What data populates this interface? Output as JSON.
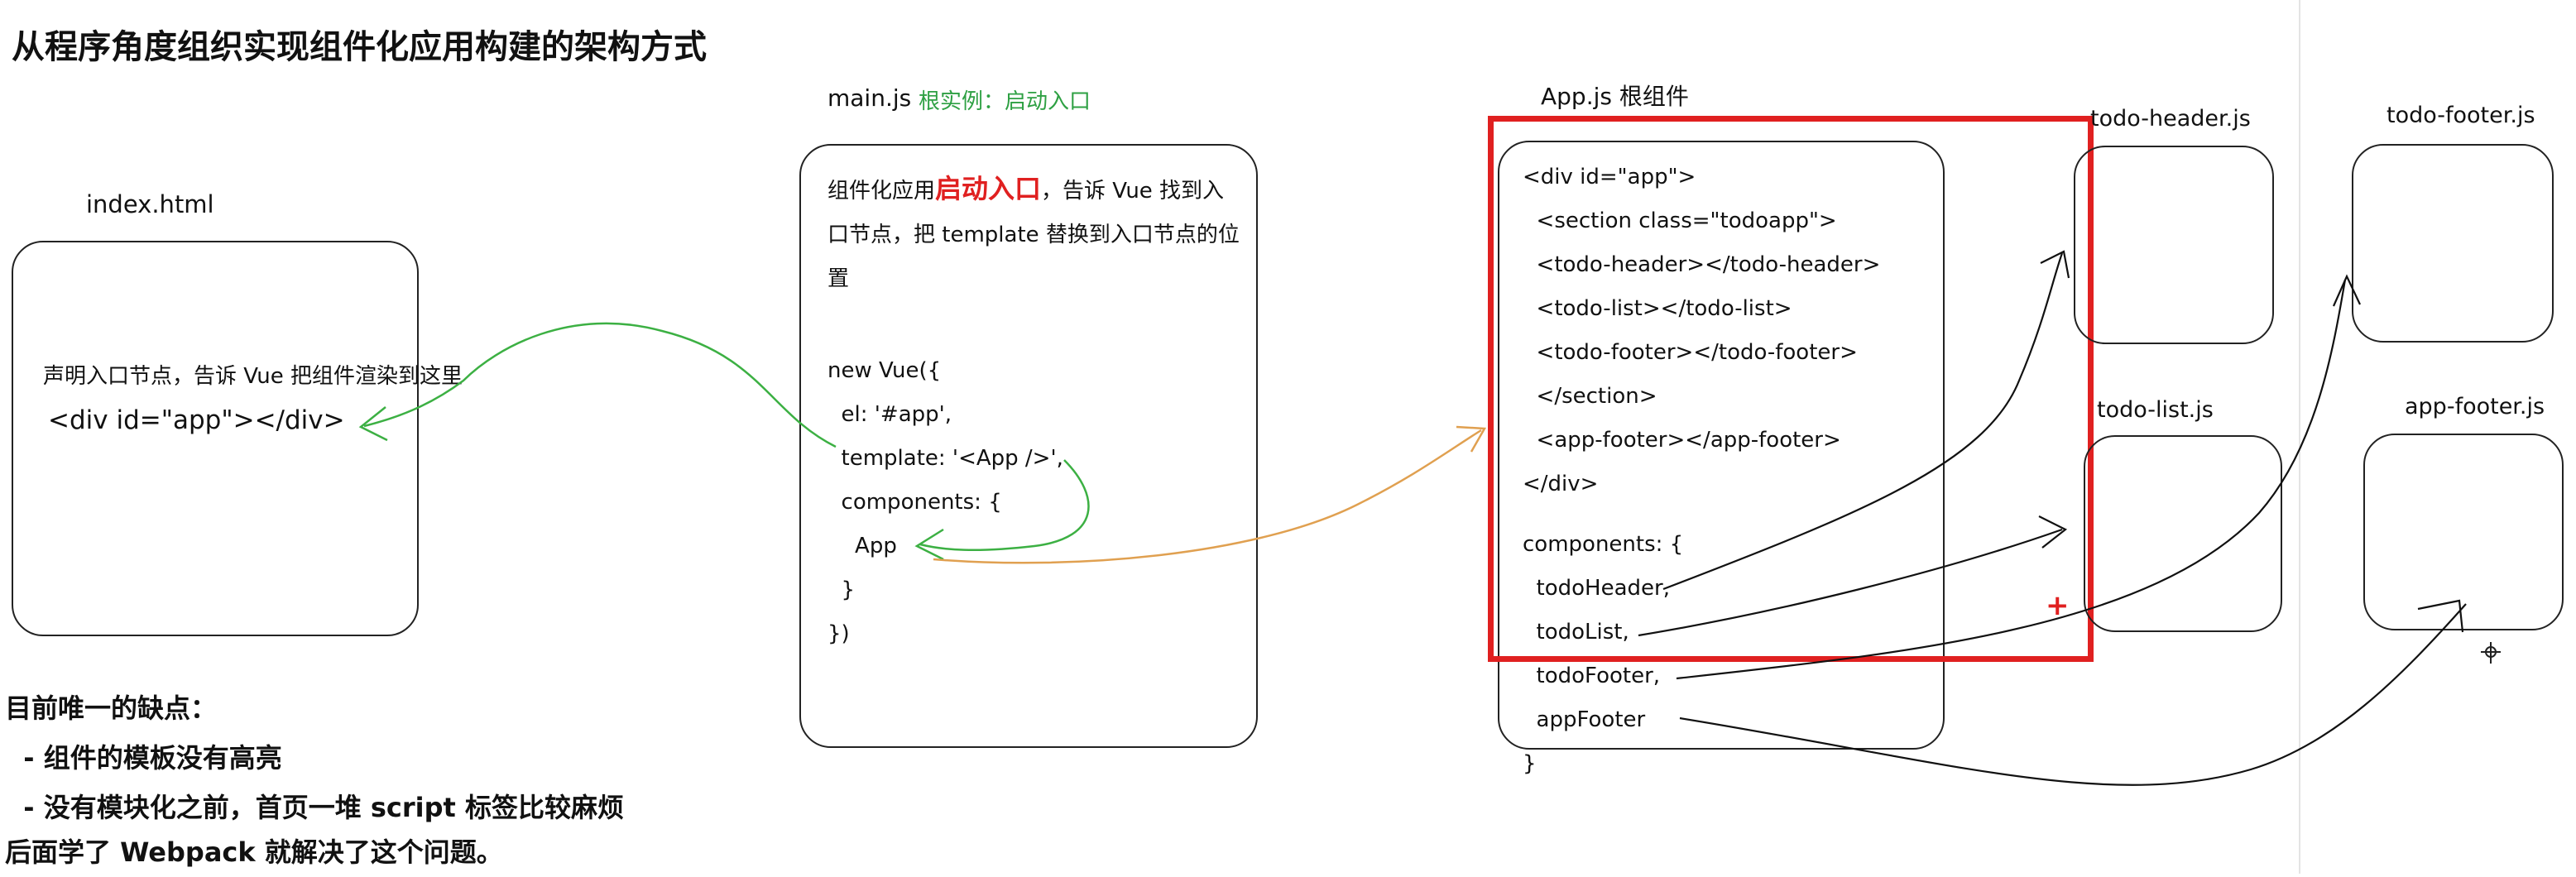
{
  "title": "从程序角度组织实现组件化应用构建的架构方式",
  "index": {
    "filename": "index.html",
    "note": "声明入口节点，告诉 Vue 把组件渲染到这里",
    "code": "<div id=\"app\"></div>"
  },
  "main": {
    "filename": "main.js",
    "tag": "根实例：启动入口",
    "desc_prefix": "组件化应用",
    "desc_highlight": "启动入口",
    "desc_suffix": "，告诉 Vue 找到入口节点，把 template 替换到入口节点的位置",
    "code": [
      "new Vue({",
      "  el: '#app',",
      "  template: '<App />',",
      "  components: {",
      "    App",
      "  }",
      "})"
    ]
  },
  "app": {
    "filename": "App.js 根组件",
    "template_code": [
      "<div id=\"app\">",
      "  <section class=\"todoapp\">",
      "  <todo-header></todo-header>",
      "  <todo-list></todo-list>",
      "  <todo-footer></todo-footer>",
      "  </section>",
      "  <app-footer></app-footer>",
      "</div>"
    ],
    "components_code": [
      "components: {",
      "  todoHeader,",
      "  todoList,",
      "  todoFooter,",
      "  appFooter",
      "}"
    ]
  },
  "components": {
    "todo_header": "todo-header.js",
    "todo_footer": "todo-footer.js",
    "todo_list": "todo-list.js",
    "app_footer": "app-footer.js"
  },
  "marks": {
    "plus": "+"
  },
  "notes": {
    "heading": "目前唯一的缺点：",
    "items": [
      "  - 组件的模板没有高亮",
      "  - 没有模块化之前，首页一堆 script 标签比较麻烦"
    ],
    "footer": "后面学了 Webpack 就解决了这个问题。"
  },
  "colors": {
    "green_arrow": "#3cb043",
    "orange_arrow": "#e0a050",
    "highlight_red": "#e02020",
    "tag_green": "#2ea043"
  }
}
